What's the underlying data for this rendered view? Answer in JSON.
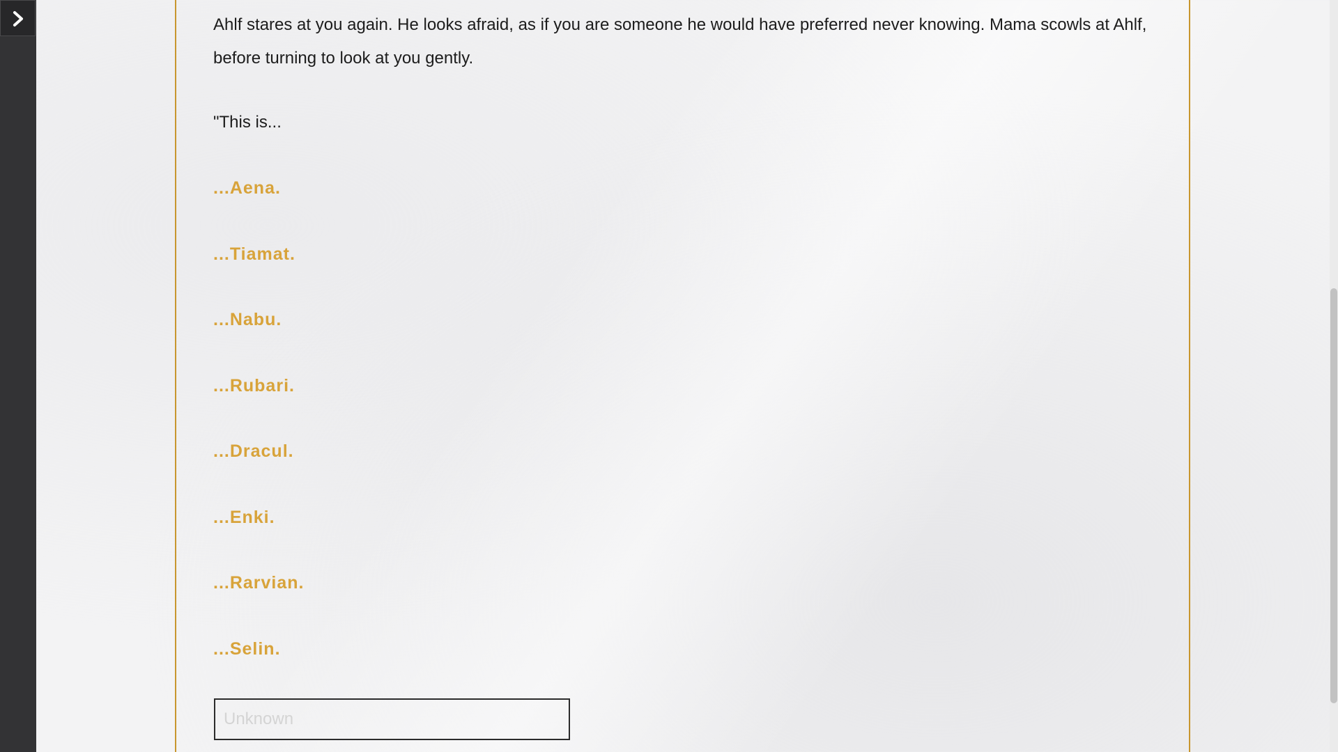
{
  "sidebar": {
    "toggle_icon": "chevron-right-icon"
  },
  "passage": {
    "paragraph": "Ahlf stares at you again. He looks afraid, as if you are someone he would have preferred never knowing. Mama scowls at Ahlf, before turning to look at you gently.",
    "intro": "\"This is...",
    "choices": [
      "...Aena.",
      "...Tiamat.",
      "...Nabu.",
      "...Rubari.",
      "...Dracul.",
      "...Enki.",
      "...Rarvian.",
      "...Selin."
    ],
    "name_input": {
      "placeholder": "Unknown",
      "value": ""
    }
  },
  "colors": {
    "accent": "#c8962e",
    "link": "#d8a33a",
    "sidebar": "#333335",
    "text": "#1c1c1c"
  }
}
